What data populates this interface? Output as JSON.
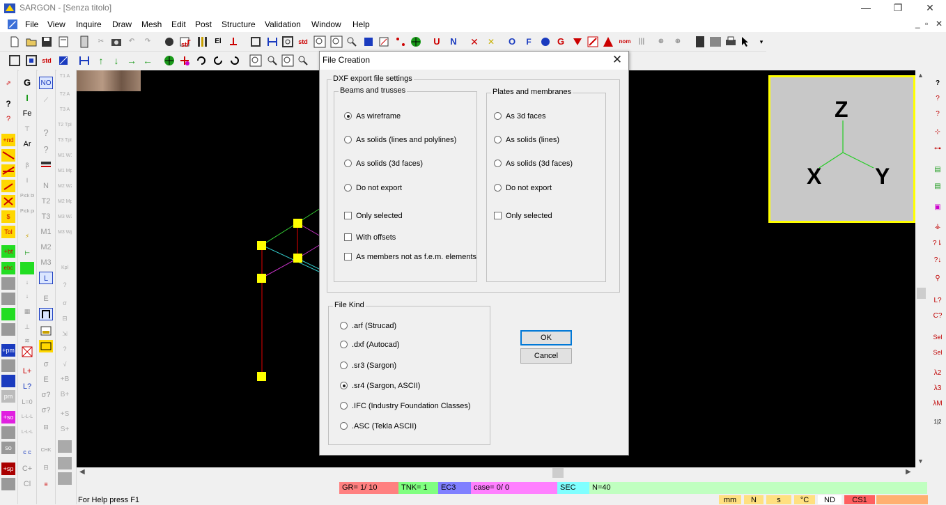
{
  "window": {
    "title": "SARGON - [Senza titolo]",
    "controls": [
      "—",
      "❐",
      "✕"
    ],
    "mdi_controls": [
      "_",
      "▫",
      "✕"
    ]
  },
  "menu": [
    "File",
    "View",
    "Inquire",
    "Draw",
    "Mesh",
    "Edit",
    "Post",
    "Structure",
    "Validation",
    "Window",
    "Help"
  ],
  "toolbar1": [
    "new-icon",
    "open-icon",
    "save-icon",
    "cut-icon",
    "copy-icon",
    "undo-icon",
    "redo-icon",
    "U",
    "N",
    "O",
    "F",
    "G",
    "nom"
  ],
  "toolbar_labels": {
    "std": "std",
    "r": "r",
    "rr": "r",
    "el": "El",
    "u": "U",
    "n": "N",
    "o": "O",
    "f": "F",
    "g": "G",
    "nom": "nom",
    "std2": "std"
  },
  "left_palette": {
    "col1": [
      "+nd",
      "Tol",
      "+bt",
      "ebc",
      "+pm",
      "+so",
      "+sp"
    ],
    "col2": [
      "G",
      "I",
      "Fe",
      "Ar",
      "Pick bt",
      "Pick pm",
      "L+",
      "L?",
      "L=0",
      "C+",
      "Cl"
    ],
    "col3": [
      "NO",
      "?",
      "?",
      "N",
      "T2",
      "T3",
      "M1",
      "M2",
      "M3",
      "L",
      "E",
      "σ",
      "E",
      "σ?",
      "σ?",
      "CHK"
    ],
    "col4": [
      "T1 A",
      "T2 A",
      "T3 A",
      "T2 Tpl2",
      "T3 Tpl3",
      "M1 W1",
      "M1 Mpl1",
      "M2 W2",
      "M2 Mpl2",
      "M3 W3",
      "M3 Wpl3",
      "Kpl",
      "+B",
      "B+",
      "+S",
      "S+"
    ]
  },
  "right_palette": [
    "?",
    "?",
    "?",
    "?↓",
    "L?",
    "C?",
    "Sel",
    "Sel",
    "λ2",
    "λ3",
    "λM",
    "1|2"
  ],
  "axis_widget": {
    "z": "Z",
    "x": "X",
    "y": "Y"
  },
  "status": {
    "gr": "GR=  1/ 10",
    "tnk": "TNK=  1",
    "ec": "EC3",
    "case": "case=    0/    0",
    "sec": "SEC",
    "n": "N=40",
    "help": "For Help press F1",
    "indicators": [
      "mm",
      "N",
      "s",
      "°C",
      "ND",
      "CS1"
    ]
  },
  "dialog": {
    "title": "File Creation",
    "dxf_group": "DXF export file settings",
    "beams_group": "Beams and trusses",
    "beams_options": [
      "As wireframe",
      "As solids (lines and polylines)",
      "As solids (3d faces)",
      "Do not export"
    ],
    "beams_selected": 0,
    "beams_checks": [
      "Only selected",
      "With offsets",
      "As members not as f.e.m. elements"
    ],
    "plates_group": "Plates and membranes",
    "plates_options": [
      "As 3d faces",
      "As solids (lines)",
      "As solids (3d faces)",
      "Do not export"
    ],
    "plates_checks": [
      "Only selected"
    ],
    "kind_group": "File Kind",
    "kind_options": [
      ".arf (Strucad)",
      ".dxf (Autocad)",
      ".sr3 (Sargon)",
      ".sr4 (Sargon, ASCII)",
      ".IFC (Industry Foundation Classes)",
      ".ASC (Tekla ASCII)"
    ],
    "kind_selected": 3,
    "ok": "OK",
    "cancel": "Cancel"
  },
  "colors": {
    "canvas": "#000000",
    "node": "#ffff00",
    "member_red": "#c00000",
    "member_green": "#33cc33",
    "member_cyan": "#33cccc",
    "member_magenta": "#cc33cc",
    "axis_frame": "#ffff00",
    "status_gr": "#ff8080",
    "status_tnk": "#80ff80",
    "status_ec": "#8080ff",
    "status_case": "#ff80ff",
    "status_sec": "#80ffff",
    "status_n": "#c0ffc0",
    "status_cs1": "#ff6060"
  }
}
